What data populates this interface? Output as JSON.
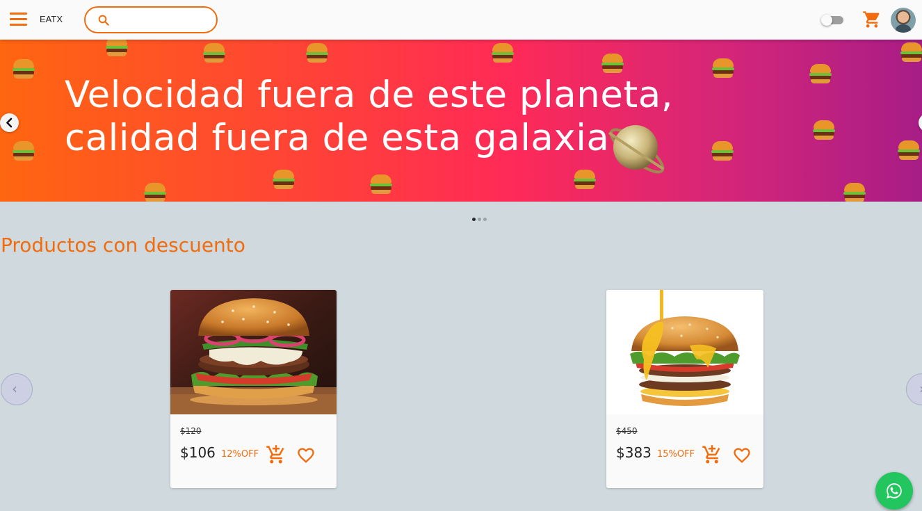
{
  "header": {
    "brand": "EATX",
    "search": {
      "placeholder": "",
      "value": ""
    },
    "dark_mode_toggle": {
      "on": false
    },
    "accent_color": "#f26c0d"
  },
  "banner": {
    "slogan_line1": "Velocidad fuera de este planeta,",
    "slogan_line2": "calidad fuera de esta galaxia",
    "active_slide": 1,
    "slide_count": 3
  },
  "section": {
    "title": "Productos con descuento"
  },
  "products": [
    {
      "old_price": "$120",
      "price": "$106",
      "discount": "12%OFF"
    },
    {
      "old_price": "$450",
      "price": "$383",
      "discount": "15%OFF"
    }
  ],
  "icons": {
    "menu": "menu-icon",
    "search": "search-icon",
    "cart": "cart-icon",
    "add_to_cart": "add-cart-icon",
    "favorite": "heart-icon",
    "whatsapp": "whatsapp-icon"
  },
  "colors": {
    "accent": "#f26c0d",
    "page_background": "#cfd9de",
    "whatsapp_green": "#22c55e"
  }
}
